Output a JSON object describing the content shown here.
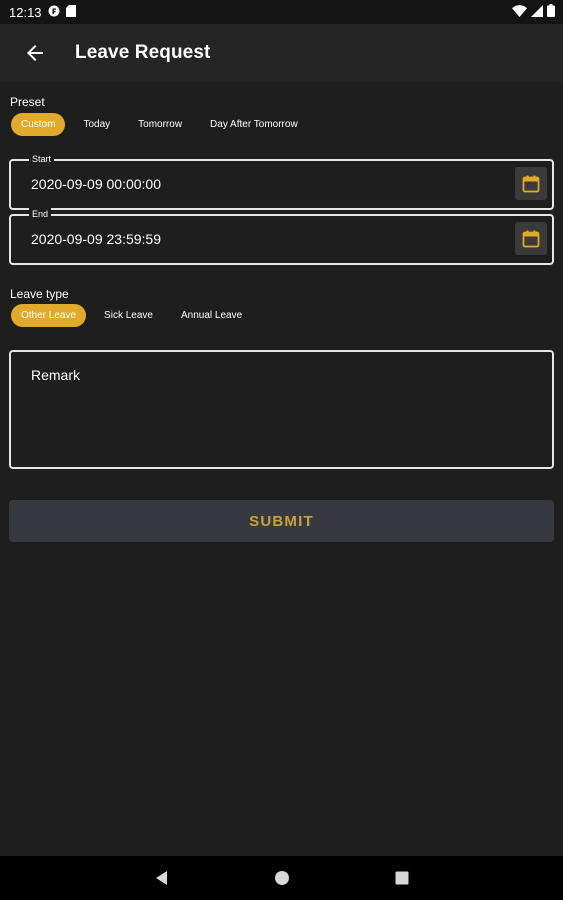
{
  "status_bar": {
    "time": "12:13",
    "left_icons": [
      "notification-app-icon",
      "sd-card-icon"
    ],
    "right_icons": [
      "wifi-icon",
      "signal-icon",
      "battery-icon"
    ]
  },
  "app_bar": {
    "back_icon": "arrow-back-icon",
    "title": "Leave Request"
  },
  "preset": {
    "label": "Preset",
    "options": [
      "Custom",
      "Today",
      "Tomorrow",
      "Day After Tomorrow"
    ],
    "selected": "Custom"
  },
  "start": {
    "label": "Start",
    "value": "2020-09-09 00:00:00",
    "icon": "calendar-icon"
  },
  "end": {
    "label": "End",
    "value": "2020-09-09 23:59:59",
    "icon": "calendar-icon"
  },
  "leave_type": {
    "label": "Leave type",
    "options": [
      "Other Leave",
      "Sick Leave",
      "Annual Leave"
    ],
    "selected": "Other Leave"
  },
  "remark": {
    "placeholder": "Remark"
  },
  "submit_label": "SUBMIT",
  "nav_bar": {
    "icons": [
      "back-triangle-icon",
      "home-circle-icon",
      "recents-square-icon"
    ]
  },
  "colors": {
    "accent": "#e2aa2a",
    "submit_text": "#c9a23d",
    "background": "#1e1e1e",
    "app_bar": "#252525",
    "submit_bg": "#363a40"
  }
}
